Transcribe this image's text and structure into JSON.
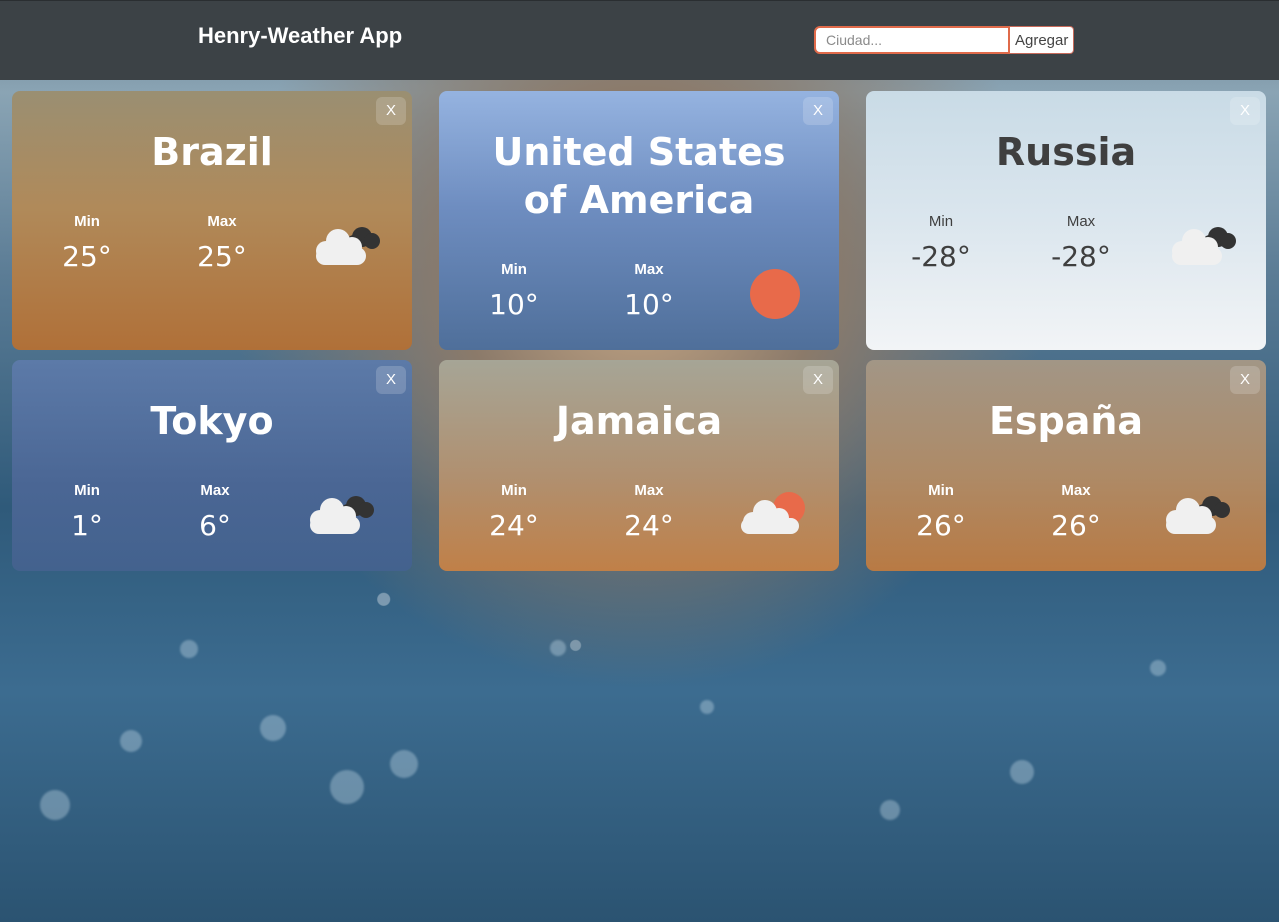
{
  "app": {
    "title": "Henry-Weather App"
  },
  "search": {
    "placeholder": "Ciudad...",
    "button_label": "Agregar"
  },
  "cards": [
    {
      "city": "Brazil",
      "min_label": "Min",
      "max_label": "Max",
      "min": "25°",
      "max": "25°",
      "icon": "cloudy-icon",
      "close_label": "X"
    },
    {
      "city": "United States of America",
      "min_label": "Min",
      "max_label": "Max",
      "min": "10°",
      "max": "10°",
      "icon": "sun-icon",
      "close_label": "X"
    },
    {
      "city": "Russia",
      "min_label": "Min",
      "max_label": "Max",
      "min": "-28°",
      "max": "-28°",
      "icon": "cloudy-icon",
      "close_label": "X"
    },
    {
      "city": "Tokyo",
      "min_label": "Min",
      "max_label": "Max",
      "min": "1°",
      "max": "6°",
      "icon": "cloudy-icon",
      "close_label": "X"
    },
    {
      "city": "Jamaica",
      "min_label": "Min",
      "max_label": "Max",
      "min": "24°",
      "max": "24°",
      "icon": "partly-cloudy-icon",
      "close_label": "X"
    },
    {
      "city": "España",
      "min_label": "Min",
      "max_label": "Max",
      "min": "26°",
      "max": "26°",
      "icon": "cloudy-icon",
      "close_label": "X"
    }
  ],
  "colors": {
    "header": "#3c4246",
    "accent": "#e06a4a",
    "sun": "#e86a4a"
  }
}
